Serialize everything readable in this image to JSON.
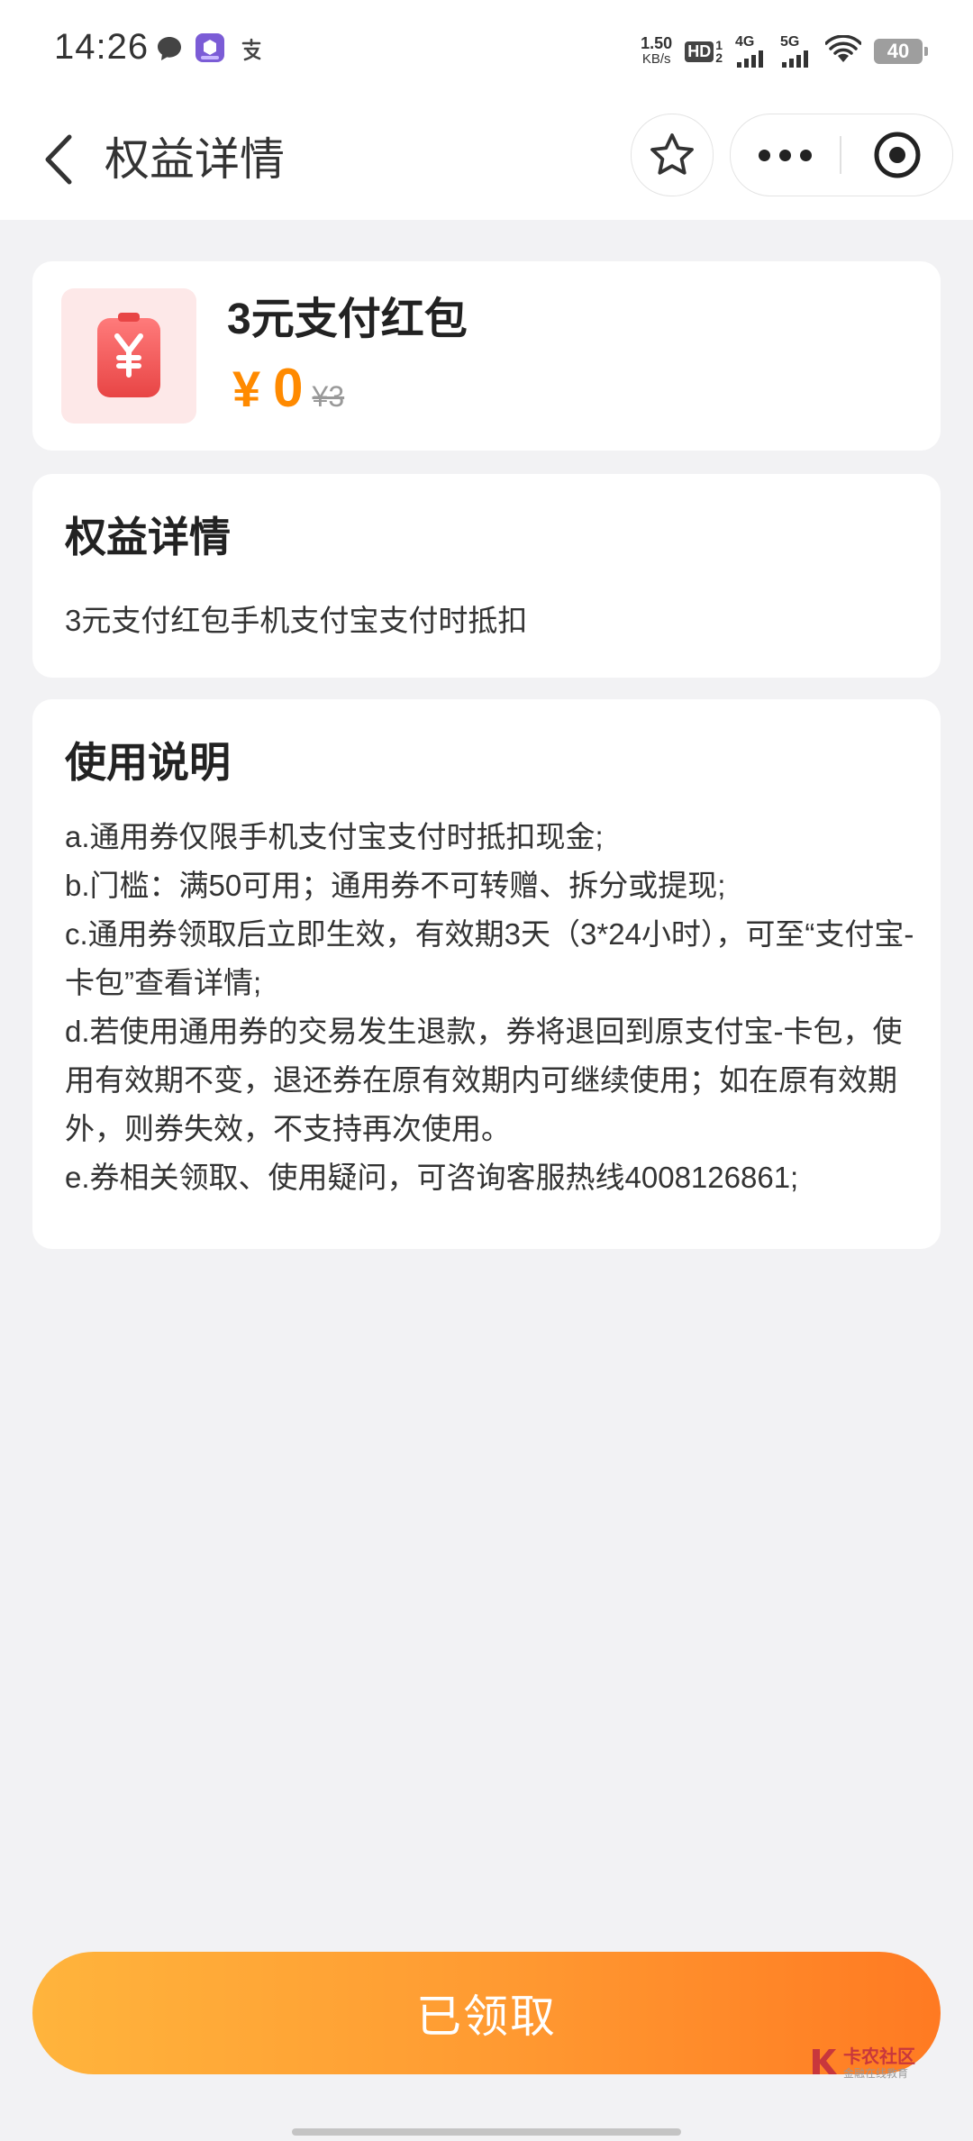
{
  "status_bar": {
    "time": "14:26",
    "net_speed_value": "1.50",
    "net_speed_unit": "KB/s",
    "hd_badge": "HD",
    "sim_numbers": "1\n2",
    "signal_1_label": "4G",
    "signal_2_label": "5G",
    "battery": "40"
  },
  "nav": {
    "title": "权益详情"
  },
  "product": {
    "name": "3元支付红包",
    "currency": "¥",
    "price": "0",
    "original_price": "¥3",
    "icon": "red-packet-icon"
  },
  "benefit": {
    "title": "权益详情",
    "text": "3元支付红包手机支付宝支付时抵扣"
  },
  "usage": {
    "title": "使用说明",
    "items": [
      "a.通用券仅限手机支付宝支付时抵扣现金;",
      "b.门槛：满50可用；通用券不可转赠、拆分或提现;",
      "c.通用券领取后立即生效，有效期3天（3*24小时），可至“支付宝-卡包”查看详情;",
      "d.若使用通用券的交易发生退款，券将退回到原支付宝-卡包，使用有效期不变，退还券在原有效期内可继续使用；如在原有效期外，则券失效，不支持再次使用。",
      "e.券相关领取、使用疑问，可咨询客服热线4008126861;"
    ]
  },
  "action": {
    "claim_label": "已领取"
  },
  "watermark": {
    "title": "卡农社区",
    "subtitle": "金融在线教育"
  },
  "colors": {
    "accent": "#ff8a00",
    "button_start": "#ffb43c",
    "button_end": "#ff7a22",
    "red_packet": "#f05a5a"
  }
}
